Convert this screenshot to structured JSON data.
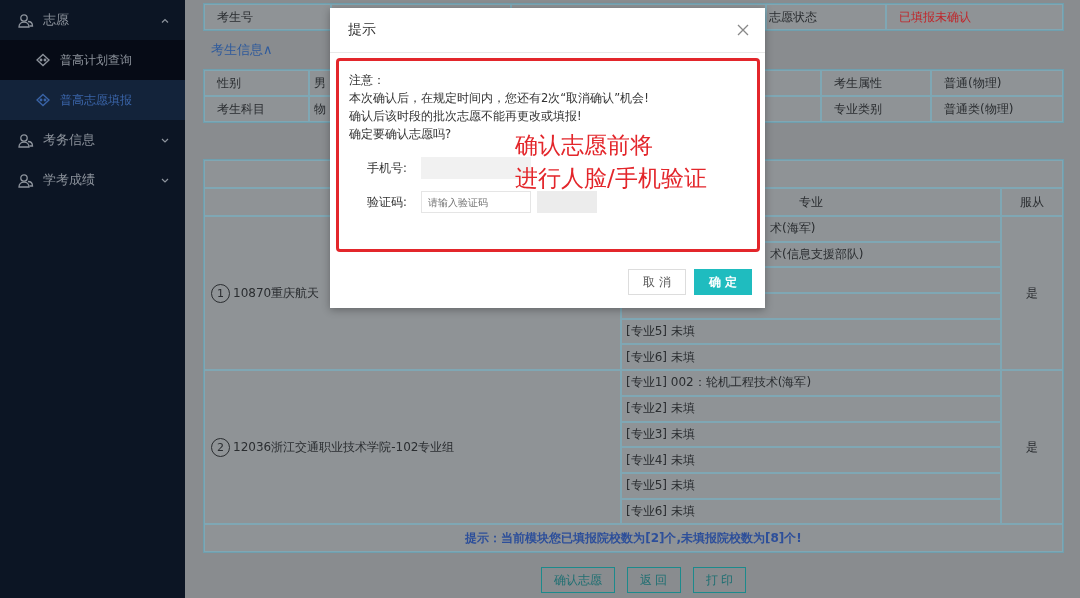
{
  "sidebar": {
    "items": [
      {
        "label": "志愿",
        "expanded": true,
        "children": [
          {
            "label": "普高计划查询",
            "selected": false
          },
          {
            "label": "普高志愿填报",
            "selected": true
          }
        ]
      },
      {
        "label": "考务信息",
        "expanded": false
      },
      {
        "label": "学考成绩",
        "expanded": false
      }
    ]
  },
  "student_row": {
    "label": "考生号",
    "status_label": "志愿状态",
    "status_value": "已填报未确认"
  },
  "info_toggle": {
    "label": "考生信息∧"
  },
  "info_table": {
    "rows": [
      {
        "label": "性别",
        "value": "男",
        "label_2": "考生属性",
        "value_2": "普通(物理)"
      },
      {
        "label": "考生科目",
        "value": "物",
        "label_2": "专业类别",
        "value_2": "普通类(物理)"
      }
    ]
  },
  "choices_table": {
    "columns": [
      "专业",
      "服从"
    ],
    "rows": [
      {
        "index": "1",
        "school": "10870重庆航天",
        "majors": [
          {
            "kind": "cut",
            "text": "术(海军)"
          },
          {
            "kind": "cut",
            "text": "术(信息支援部队)"
          },
          {
            "kind": "hidden"
          },
          {
            "kind": "hidden"
          },
          {
            "kind": "full",
            "text": "[专业5] 未填"
          },
          {
            "kind": "full",
            "text": "[专业6] 未填"
          }
        ],
        "obey": "是"
      },
      {
        "index": "2",
        "school": "12036浙江交通职业技术学院-102专业组",
        "majors": [
          {
            "kind": "full",
            "text": "[专业1] 002：轮机工程技术(海军)"
          },
          {
            "kind": "full",
            "text": "[专业2] 未填"
          },
          {
            "kind": "full",
            "text": "[专业3] 未填"
          },
          {
            "kind": "full",
            "text": "[专业4] 未填"
          },
          {
            "kind": "full",
            "text": "[专业5] 未填"
          },
          {
            "kind": "full",
            "text": "[专业6] 未填"
          }
        ],
        "obey": "是"
      }
    ],
    "hint": "提示：当前模块您已填报院校数为[2]个,未填报院校数为[8]个!"
  },
  "actions": [
    "确认志愿",
    "返 回",
    "打 印"
  ],
  "dialog": {
    "title": "提示",
    "lines": [
      "注意：",
      "本次确认后，在规定时间内，您还有2次“取消确认”机会!",
      "确认后该时段的批次志愿不能再更改或填报!",
      "确定要确认志愿吗?"
    ],
    "phone_label": "手机号:",
    "code_label": "验证码:",
    "code_placeholder": "请输入验证码",
    "buttons": [
      {
        "label": "取 消",
        "kind": "secondary"
      },
      {
        "label": "确 定",
        "kind": "primary"
      }
    ]
  },
  "annotation": {
    "lines": [
      "确认志愿前将",
      "进行人脸/手机验证"
    ]
  }
}
